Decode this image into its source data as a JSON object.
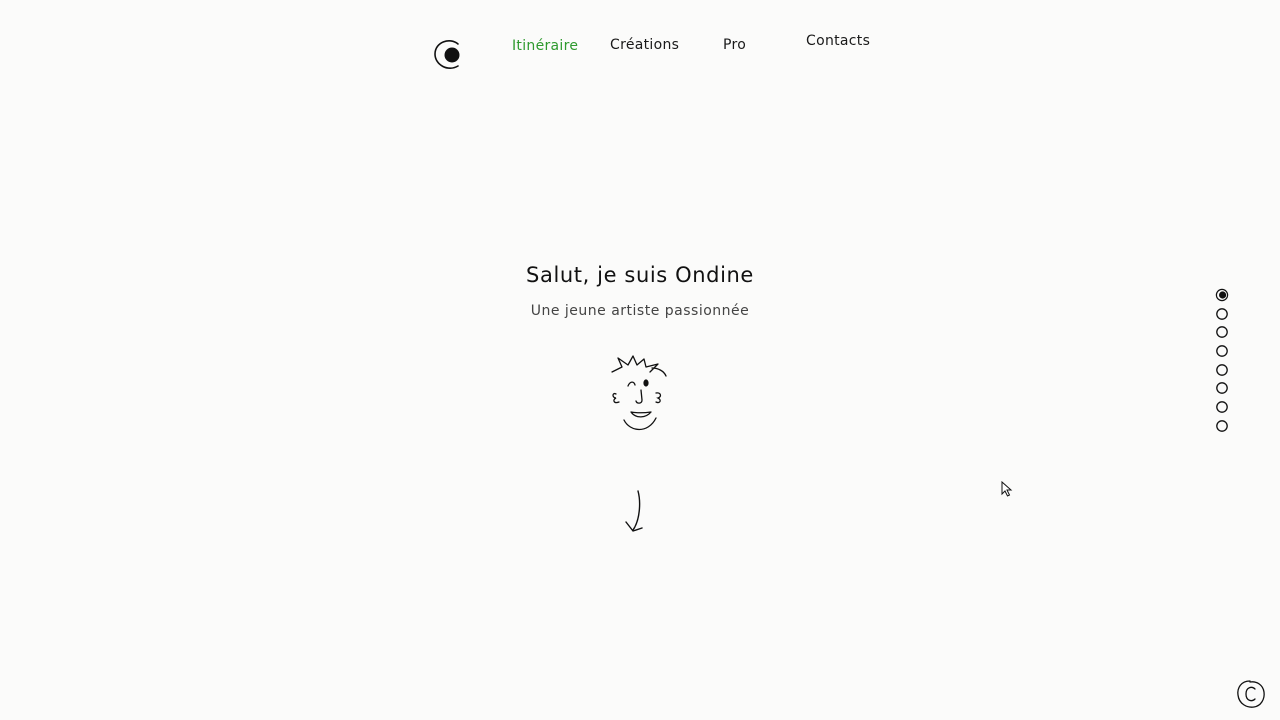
{
  "header": {
    "logo_icon": "circle-dot-logo-icon",
    "nav": [
      {
        "label": "Itinéraire",
        "active": true
      },
      {
        "label": "Créations",
        "active": false
      },
      {
        "label": "Pro",
        "active": false
      },
      {
        "label": "Contacts",
        "active": false
      }
    ]
  },
  "hero": {
    "title": "Salut, je suis Ondine",
    "subtitle": "Une jeune artiste passionnée",
    "avatar_icon": "winking-face-doodle-icon",
    "scroll_icon": "arrow-down-icon"
  },
  "section_dots": {
    "count": 8,
    "active_index": 0
  },
  "footer": {
    "copyright_icon": "copyright-icon"
  },
  "colors": {
    "background": "#fbfbfa",
    "text": "#111111",
    "accent_active_nav": "#2e9a2e"
  }
}
